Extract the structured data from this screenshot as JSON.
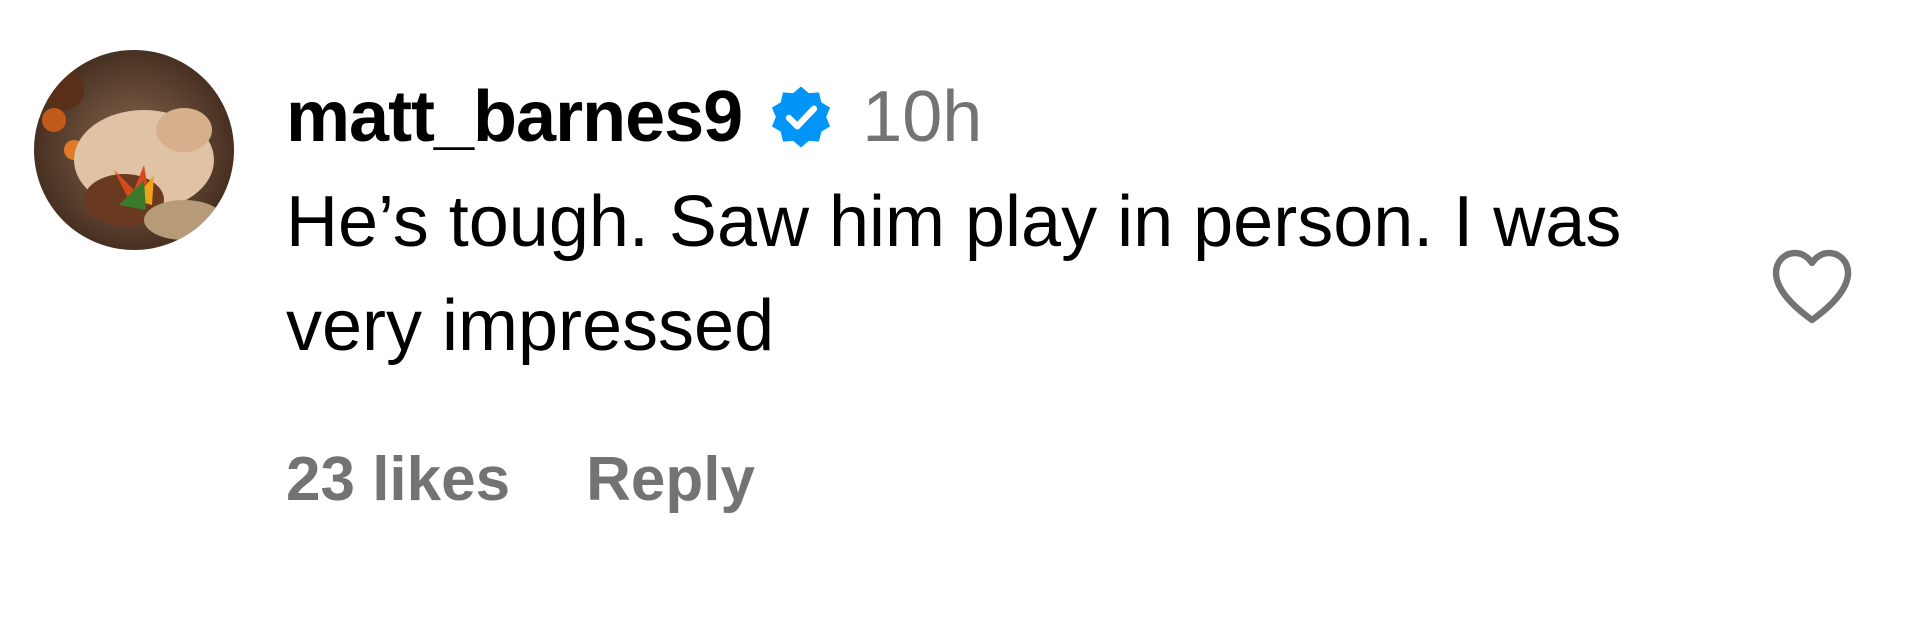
{
  "comment": {
    "username": "matt_barnes9",
    "verified": true,
    "timestamp": "10h",
    "text": "He’s tough. Saw him play in person. I was very impressed",
    "likes_label": "23 likes",
    "reply_label": "Reply"
  },
  "icons": {
    "verified": "verified-badge-icon",
    "like": "heart-outline-icon",
    "avatar": "user-avatar"
  },
  "colors": {
    "primary_text": "#000000",
    "secondary_text": "#737373",
    "verified_blue": "#0095F6",
    "heart_outline": "#737373"
  }
}
